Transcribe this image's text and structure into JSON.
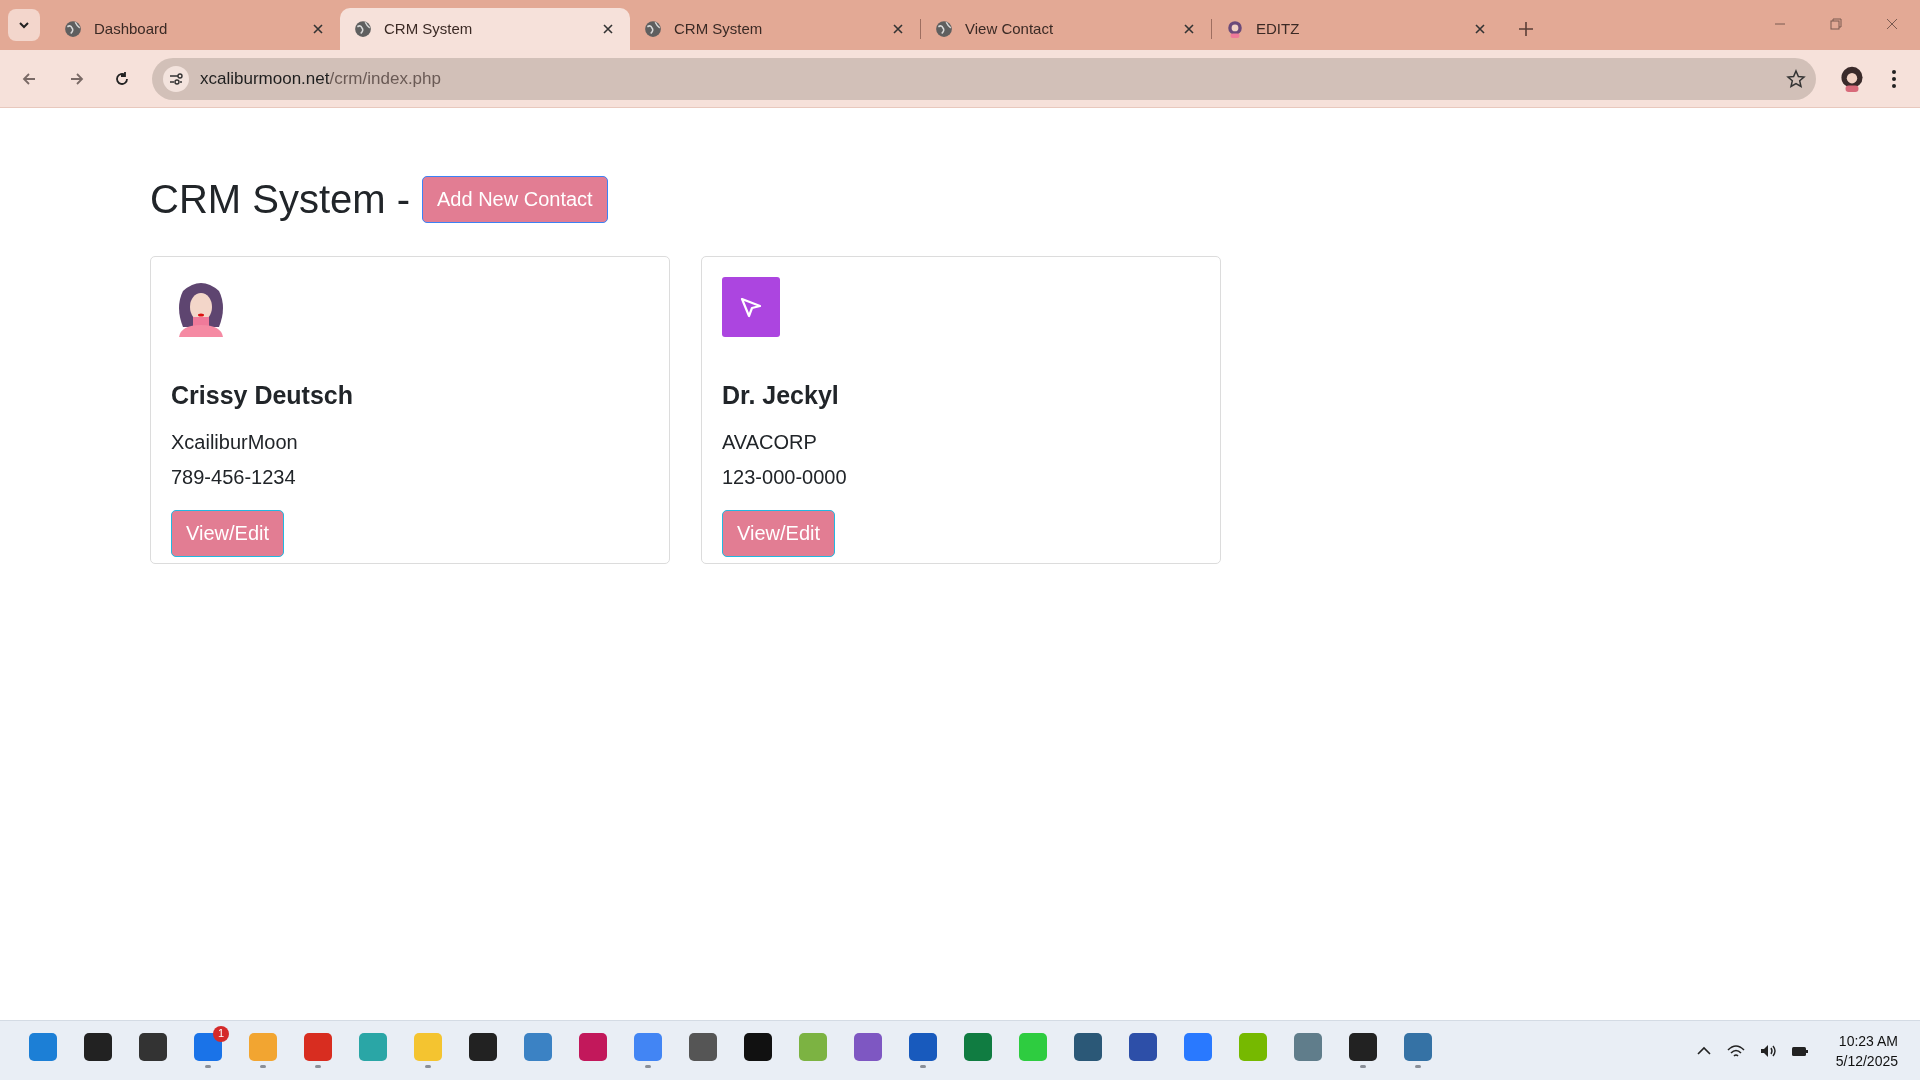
{
  "browser": {
    "tabs": [
      {
        "title": "Dashboard",
        "selected": false,
        "kind": "globe"
      },
      {
        "title": "CRM System",
        "selected": true,
        "kind": "globe"
      },
      {
        "title": "CRM System",
        "selected": false,
        "kind": "globe"
      },
      {
        "title": "View Contact",
        "selected": false,
        "kind": "globe"
      },
      {
        "title": "EDITZ",
        "selected": false,
        "kind": "avatar"
      }
    ],
    "url_host": "xcaliburmoon.net",
    "url_path": "/crm/index.php"
  },
  "page": {
    "title": "CRM System -",
    "add_button": "Add New Contact",
    "contacts": [
      {
        "name": "Crissy Deutsch",
        "company": "XcailiburMoon",
        "phone": "789-456-1234",
        "kind": "person",
        "button": "View/Edit"
      },
      {
        "name": "Dr. Jeckyl",
        "company": "AVACORP",
        "phone": "123-000-0000",
        "kind": "logo",
        "button": "View/Edit"
      }
    ]
  },
  "taskbar": {
    "apps": [
      {
        "running": false
      },
      {
        "running": false
      },
      {
        "running": false
      },
      {
        "running": true,
        "badge": "1"
      },
      {
        "running": true
      },
      {
        "running": true
      },
      {
        "running": false
      },
      {
        "running": true
      },
      {
        "running": false
      },
      {
        "running": false
      },
      {
        "running": false
      },
      {
        "running": true
      },
      {
        "running": false
      },
      {
        "running": false
      },
      {
        "running": false
      },
      {
        "running": false
      },
      {
        "running": true
      },
      {
        "running": false
      },
      {
        "running": false
      },
      {
        "running": false
      },
      {
        "running": false
      },
      {
        "running": false
      },
      {
        "running": false
      },
      {
        "running": false
      },
      {
        "running": true
      },
      {
        "running": true
      }
    ],
    "time": "10:23 AM",
    "date": "5/12/2025"
  }
}
